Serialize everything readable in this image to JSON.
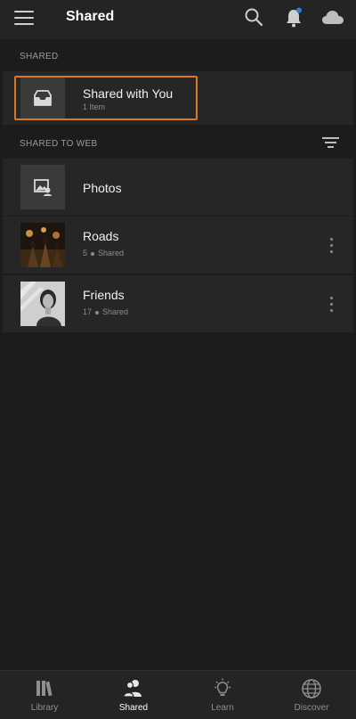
{
  "header": {
    "title": "Shared"
  },
  "colors": {
    "background": "#1c1c1c",
    "panel": "#262626",
    "accent_outline": "#d67a22",
    "notification_dot": "#2c7be5"
  },
  "icons": [
    "menu-icon",
    "search-icon",
    "bell-icon",
    "cloud-icon",
    "inbox-icon",
    "sort-icon",
    "photos-icon",
    "more-vertical-icon",
    "library-icon",
    "shared-icon",
    "learn-icon",
    "discover-icon"
  ],
  "shared_section": {
    "heading": "SHARED",
    "item": {
      "title": "Shared with You",
      "subtitle": "1 Item"
    }
  },
  "web_section": {
    "heading": "SHARED TO WEB",
    "items": [
      {
        "title": "Photos"
      },
      {
        "title": "Roads",
        "count": "5",
        "status": "Shared"
      },
      {
        "title": "Friends",
        "count": "17",
        "status": "Shared"
      }
    ]
  },
  "bottom_nav": {
    "tabs": [
      {
        "label": "Library"
      },
      {
        "label": "Shared"
      },
      {
        "label": "Learn"
      },
      {
        "label": "Discover"
      }
    ],
    "active": "Shared"
  }
}
